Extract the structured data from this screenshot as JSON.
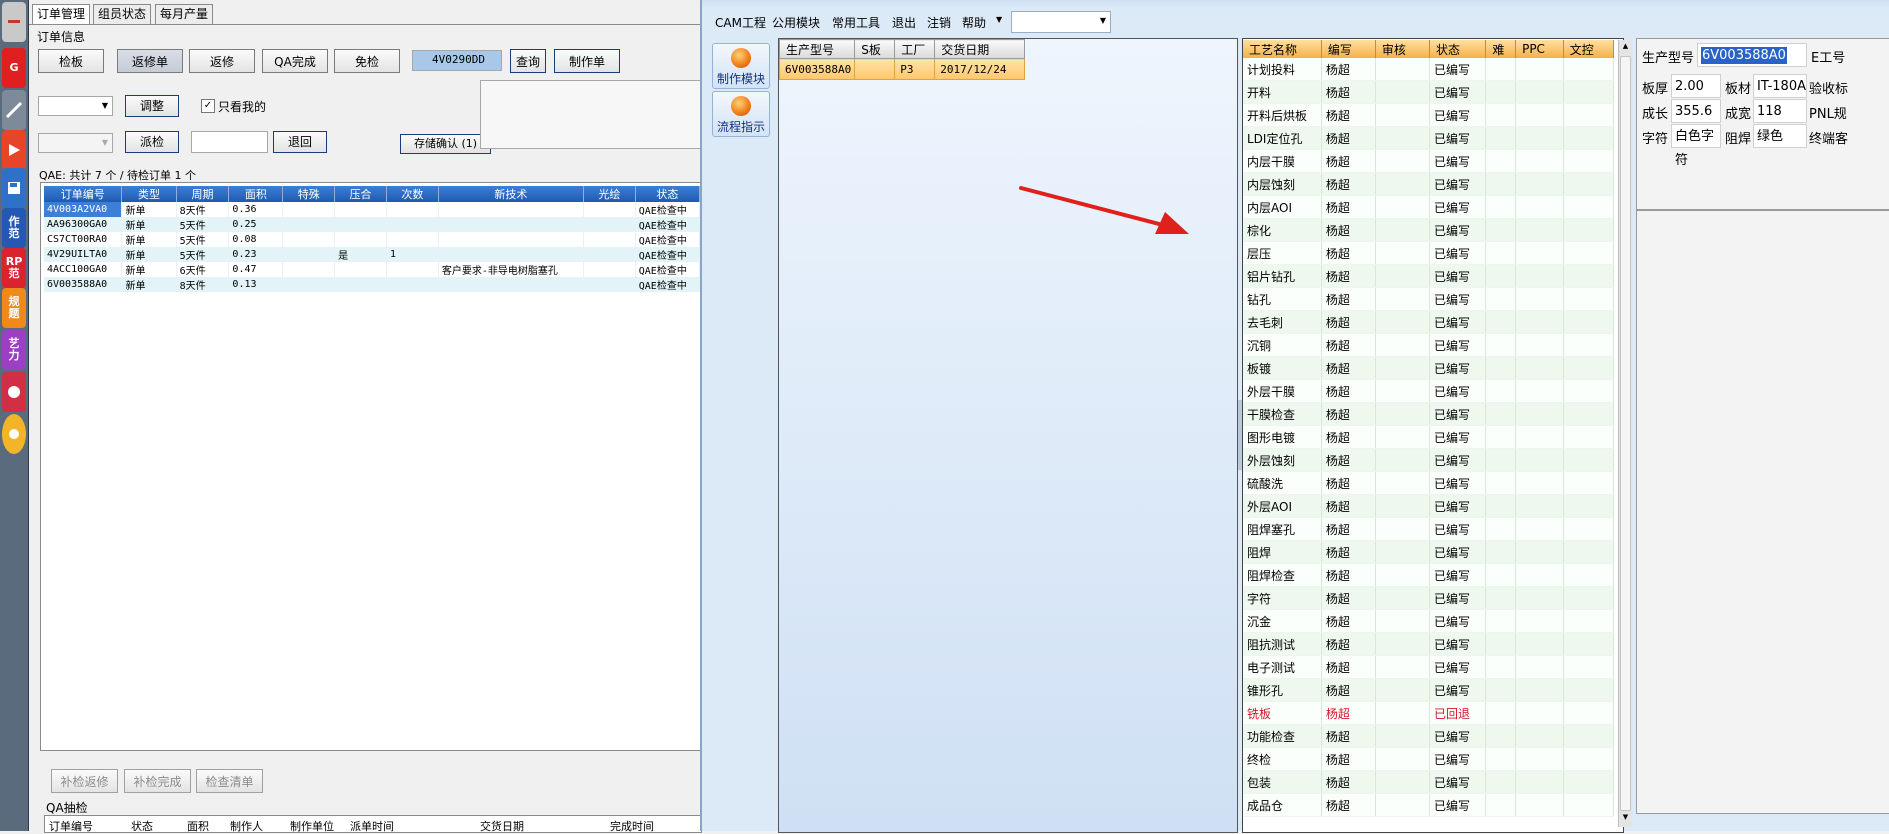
{
  "left_app": {
    "tabs": [
      "订单管理",
      "组员状态",
      "每月产量"
    ],
    "section_order_info": "订单信息",
    "buttons_row1": [
      "检板",
      "返修单",
      "返修",
      "QA完成",
      "免检"
    ],
    "search_value": "4V0290DD",
    "query_label": "查询",
    "make_order_label": "制作单",
    "adjust_label": "调整",
    "only_mine_label": "只看我的",
    "dispatch_label": "派检",
    "return_label": "退回",
    "stock_confirm_label": "存储确认 (1)",
    "summary": "QAE: 共计 7 个 / 待检订单 1 个",
    "table": {
      "headers": [
        "订单编号",
        "类型",
        "周期",
        "面积",
        "特殊",
        "压合",
        "次数",
        "新技术",
        "光绘",
        "状态"
      ],
      "rows": [
        [
          "4V003A2VA0",
          "新单",
          "8天件",
          "0.36",
          "",
          "",
          "",
          "",
          "",
          "QAE检查中"
        ],
        [
          "AA96300GA0",
          "新单",
          "5天件",
          "0.25",
          "",
          "",
          "",
          "",
          "",
          "QAE检查中"
        ],
        [
          "CS7CT00RA0",
          "新单",
          "5天件",
          "0.08",
          "",
          "",
          "",
          "",
          "",
          "QAE检查中"
        ],
        [
          "4V29UILTA0",
          "新单",
          "5天件",
          "0.23",
          "",
          "是",
          "1",
          "",
          "",
          "QAE检查中"
        ],
        [
          "4ACC100GA0",
          "新单",
          "6天件",
          "0.47",
          "",
          "",
          "",
          "客户要求-非导电树脂塞孔",
          "",
          "QAE检查中"
        ],
        [
          "6V003588A0",
          "新单",
          "8天件",
          "0.13",
          "",
          "",
          "",
          "",
          "",
          "QAE检查中"
        ]
      ]
    },
    "bottom_buttons": [
      "补检返修",
      "补检完成",
      "检查清单"
    ],
    "qa_section": "QA抽检",
    "qa_headers": [
      "订单编号",
      "状态",
      "面积",
      "制作人",
      "制作单位",
      "派单时间",
      "交货日期",
      "完成时间"
    ]
  },
  "cam_window": {
    "menu": [
      "CAM工程",
      "公用模块",
      "常用工具",
      "退出",
      "注销",
      "帮助"
    ],
    "side_buttons": [
      "制作模块",
      "流程指示"
    ],
    "product_table": {
      "headers": [
        "生产型号",
        "S板",
        "工厂",
        "交货日期"
      ],
      "rows": [
        [
          "6V003588A0",
          "",
          "P3",
          "2017/12/24"
        ]
      ]
    },
    "process_table": {
      "headers": [
        "工艺名称",
        "编写",
        "审核",
        "状态",
        "难",
        "PPC",
        "文控"
      ],
      "rows": [
        [
          "计划投料",
          "杨超",
          "",
          "已编写"
        ],
        [
          "开料",
          "杨超",
          "",
          "已编写"
        ],
        [
          "开料后烘板",
          "杨超",
          "",
          "已编写"
        ],
        [
          "LDI定位孔",
          "杨超",
          "",
          "已编写"
        ],
        [
          "内层干膜",
          "杨超",
          "",
          "已编写"
        ],
        [
          "内层蚀刻",
          "杨超",
          "",
          "已编写"
        ],
        [
          "内层AOI",
          "杨超",
          "",
          "已编写"
        ],
        [
          "棕化",
          "杨超",
          "",
          "已编写"
        ],
        [
          "层压",
          "杨超",
          "",
          "已编写"
        ],
        [
          "铝片钻孔",
          "杨超",
          "",
          "已编写"
        ],
        [
          "钻孔",
          "杨超",
          "",
          "已编写"
        ],
        [
          "去毛刺",
          "杨超",
          "",
          "已编写"
        ],
        [
          "沉铜",
          "杨超",
          "",
          "已编写"
        ],
        [
          "板镀",
          "杨超",
          "",
          "已编写"
        ],
        [
          "外层干膜",
          "杨超",
          "",
          "已编写"
        ],
        [
          "干膜检查",
          "杨超",
          "",
          "已编写"
        ],
        [
          "图形电镀",
          "杨超",
          "",
          "已编写"
        ],
        [
          "外层蚀刻",
          "杨超",
          "",
          "已编写"
        ],
        [
          "硫酸洗",
          "杨超",
          "",
          "已编写"
        ],
        [
          "外层AOI",
          "杨超",
          "",
          "已编写"
        ],
        [
          "阻焊塞孔",
          "杨超",
          "",
          "已编写"
        ],
        [
          "阻焊",
          "杨超",
          "",
          "已编写"
        ],
        [
          "阻焊检查",
          "杨超",
          "",
          "已编写"
        ],
        [
          "字符",
          "杨超",
          "",
          "已编写"
        ],
        [
          "沉金",
          "杨超",
          "",
          "已编写"
        ],
        [
          "阻抗测试",
          "杨超",
          "",
          "已编写"
        ],
        [
          "电子测试",
          "杨超",
          "",
          "已编写"
        ],
        [
          "锥形孔",
          "杨超",
          "",
          "已编写"
        ],
        [
          "铣板",
          "杨超",
          "",
          "已回退"
        ],
        [
          "功能检查",
          "杨超",
          "",
          "已编写"
        ],
        [
          "终检",
          "杨超",
          "",
          "已编写"
        ],
        [
          "包装",
          "杨超",
          "",
          "已编写"
        ],
        [
          "成品仓",
          "杨超",
          "",
          "已编写"
        ]
      ]
    },
    "info": {
      "model_label": "生产型号",
      "model_value": "6V003588A0",
      "eng_label": "E工号",
      "thickness_label": "板厚",
      "thickness_value": "2.00",
      "material_label": "板材",
      "material_value": "IT-180A",
      "accept_label": "验收标",
      "length_label": "成长",
      "length_value": "355.6",
      "width_label": "成宽",
      "width_value": "118",
      "pnl_label": "PNL规",
      "char_label": "字符",
      "char_value": "白色字符",
      "mask_label": "阻焊",
      "mask_value": "绿色",
      "customer_label": "终端客"
    }
  },
  "colors": {
    "accent_blue": "#1d5bb0",
    "highlight_orange": "#ffc76b",
    "returned_red": "#d4152b",
    "arrow_red": "#e0201a"
  }
}
